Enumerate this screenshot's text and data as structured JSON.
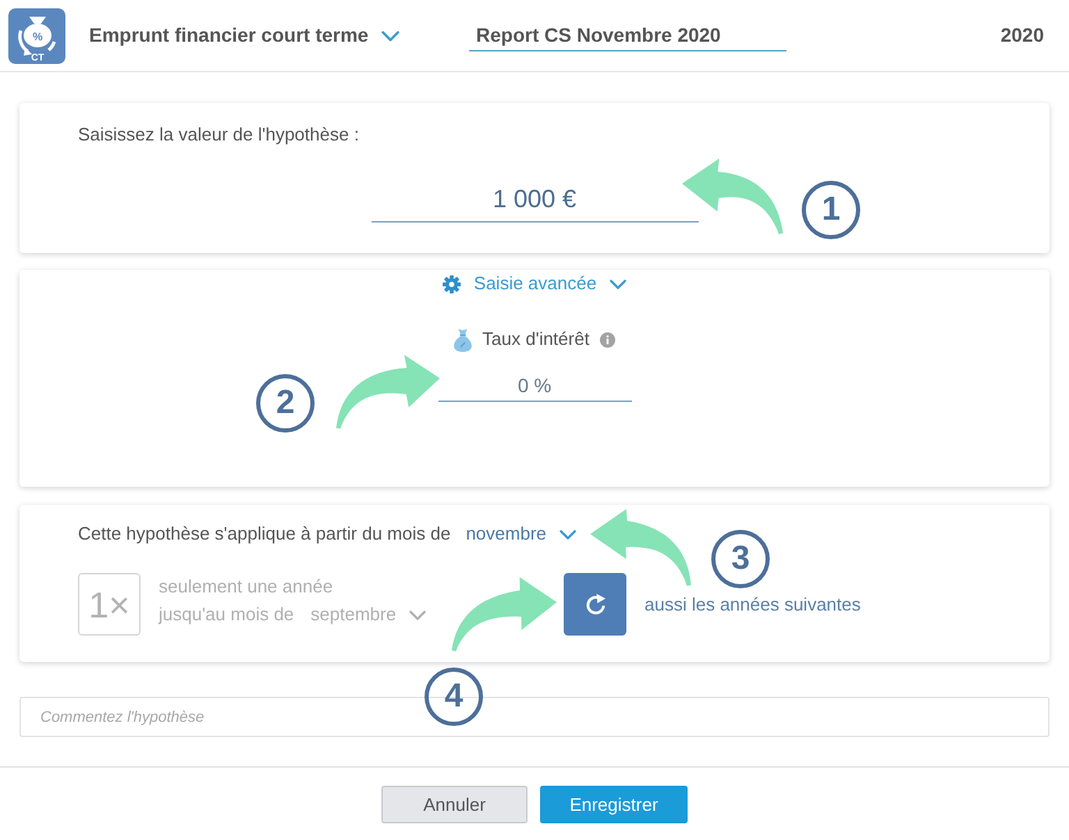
{
  "header": {
    "logo_symbol": "%",
    "logo_caption": "CT",
    "title": "Emprunt financier court terme",
    "report_name": "Report CS Novembre 2020",
    "year": "2020"
  },
  "value_card": {
    "label": "Saisissez la valeur de l'hypothèse :",
    "value": "1 000 €"
  },
  "advanced": {
    "toggle_label": "Saisie avancée",
    "expanded": true,
    "field_label": "Taux d'intérêt",
    "value": "0 %"
  },
  "period": {
    "start_label": "Cette hypothèse s'applique à partir du mois de",
    "start_month": "novembre",
    "options": [
      {
        "kind": "once",
        "selected": false,
        "button_label": "1×",
        "caption": "seulement une année",
        "until_label": "jusqu'au mois de",
        "until_month": "septembre"
      },
      {
        "kind": "recurring",
        "selected": true,
        "caption": "aussi les années suivantes"
      }
    ]
  },
  "comment": {
    "placeholder": "Commentez l'hypothèse"
  },
  "buttons": [
    {
      "kind": "secondary",
      "label": "Annuler"
    },
    {
      "kind": "primary",
      "label": "Enregistrer"
    }
  ],
  "annotations": [
    {
      "number": "1"
    },
    {
      "number": "2"
    },
    {
      "number": "3"
    },
    {
      "number": "4"
    }
  ]
}
